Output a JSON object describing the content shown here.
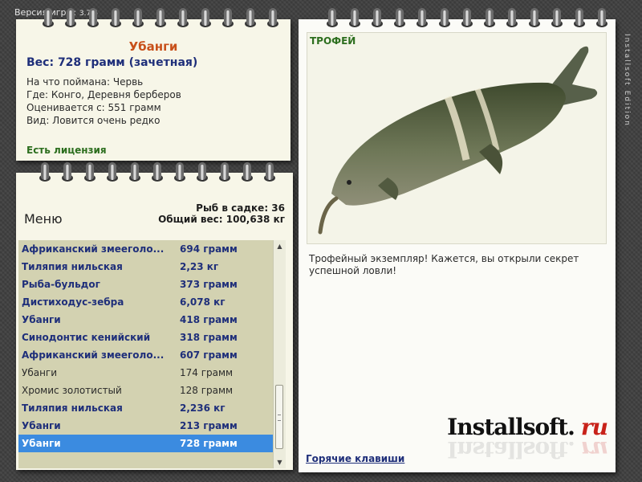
{
  "app": {
    "version_label": "Версия игры:",
    "version_number": "3.7.6",
    "side_text": "Installsoft Edition"
  },
  "info": {
    "fish_name": "Убанги",
    "weight_line": "Вес: 728 грамм (зачетная)",
    "caught_with": "На что поймана: Червь",
    "location": "Где: Конго, Деревня берберов",
    "min_weight": "Оценивается с: 551 грамм",
    "rarity": "Вид: Ловится очень редко",
    "license": "Есть лицензия"
  },
  "menu": {
    "title": "Меню",
    "fish_count": "Рыб в садке: 36",
    "total_weight": "Общий вес: 100,638 кг",
    "rows": [
      {
        "name": "Африканский змееголо...",
        "weight": "694 грамм",
        "style": "bold"
      },
      {
        "name": "Тиляпия нильская",
        "weight": "2,23 кг",
        "style": "bold"
      },
      {
        "name": "Рыба-бульдог",
        "weight": "373 грамм",
        "style": "bold"
      },
      {
        "name": "Дистиходус-зебра",
        "weight": "6,078 кг",
        "style": "bold"
      },
      {
        "name": "Убанги",
        "weight": "418 грамм",
        "style": "bold"
      },
      {
        "name": "Синодонтис кенийский",
        "weight": "318 грамм",
        "style": "bold"
      },
      {
        "name": "Африканский змееголо...",
        "weight": "607 грамм",
        "style": "bold"
      },
      {
        "name": "Убанги",
        "weight": "174 грамм",
        "style": "plain"
      },
      {
        "name": "Хромис золотистый",
        "weight": "128 грамм",
        "style": "plain"
      },
      {
        "name": "Тиляпия нильская",
        "weight": "2,236 кг",
        "style": "bold"
      },
      {
        "name": "Убанги",
        "weight": "213 грамм",
        "style": "bold"
      },
      {
        "name": "Убанги",
        "weight": "728 грамм",
        "style": "sel"
      }
    ],
    "scroll_up": "▲",
    "scroll_down": "▼"
  },
  "trophy": {
    "label": "ТРОФЕЙ",
    "description": "Трофейный экземпляр! Кажется, вы открыли секрет успешной ловли!",
    "hotkeys": "Горячие клавиши",
    "brand_main": "Installsoft.",
    "brand_ru": "ru"
  },
  "colors": {
    "accent_name": "#c8501a",
    "link_blue": "#1f2f7a",
    "license_green": "#2c6e1e",
    "selection": "#3b8be0"
  }
}
